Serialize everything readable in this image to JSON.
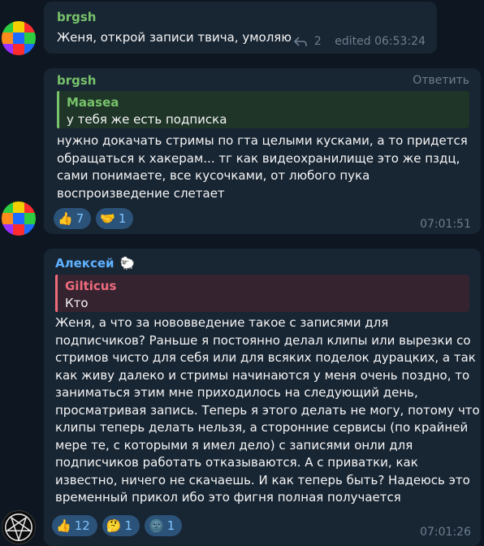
{
  "messages": [
    {
      "author": "brgsh",
      "author_color": "#77c26a",
      "text": "Женя, открой записи твича, умоляю",
      "forwards": "2",
      "edited_time": "edited 06:53:24"
    },
    {
      "author": "brgsh",
      "author_color": "#77c26a",
      "reply_label": "Ответить",
      "quote": {
        "name": "Maasea",
        "name_color": "#77c26a",
        "text": "у тебя же есть подписка"
      },
      "lines": [
        "нужно докачать стримы по гта целыми кусками, а то придется",
        "обращаться к хакерам... тг как видеохранилище это же пздц,",
        "сами понимаете, все кусочками, от любого пука",
        "воспроизведение слетает"
      ],
      "reactions": [
        {
          "emoji": "👍",
          "count": "7"
        },
        {
          "emoji": "🤝",
          "count": "1"
        }
      ],
      "time": "07:01:51"
    },
    {
      "author": "Алексей",
      "author_color": "#5fb2ff",
      "badge": "🐑",
      "quote": {
        "name": "Gilticus",
        "name_color": "#ee6b7c",
        "text": "Кто"
      },
      "lines": [
        "Женя, а что за нововведение такое с записями для",
        "подписчиков? Раньше я постоянно делал клипы или вырезки со",
        "стримов чисто для себя или для всяких поделок дурацких, а так",
        "как живу далеко и стримы начинаются у меня очень поздно, то",
        "заниматься этим мне приходилось на следующий день,",
        "просматривая запись. Теперь я этого делать не могу, потому что",
        "клипы теперь делать нельзя, а сторонние сервисы (по крайней",
        "мере те, с которыми я имел дело) с записями онли для",
        "подписчиков работать отказываются. А с приватки, как",
        "известно, ничего не скачаешь. И как теперь быть? Надеюсь это",
        "временный прикол ибо это фигня полная получается"
      ],
      "reactions": [
        {
          "emoji": "👍",
          "count": "12"
        },
        {
          "emoji": "🤔",
          "count": "1"
        },
        {
          "emoji": "🌚",
          "count": "1"
        }
      ],
      "time": "07:01:26"
    }
  ],
  "colors": {
    "background": "#0e1621",
    "bubble": "#182533",
    "reaction_bg": "#2b5278",
    "meta": "#6d7f8f"
  }
}
